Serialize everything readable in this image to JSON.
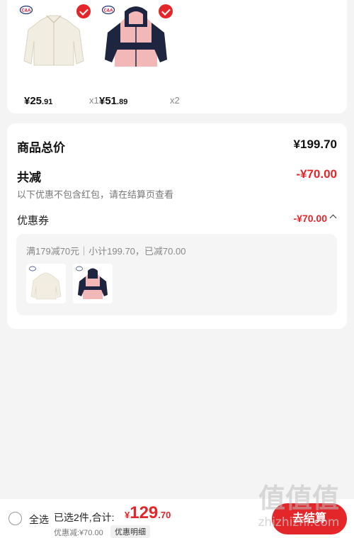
{
  "products": [
    {
      "name": "cream-fleece-jacket",
      "price_int": "¥25",
      "price_dec": ".91",
      "qty": "x1",
      "brand": "C&A"
    },
    {
      "name": "pink-navy-hooded-jacket",
      "price_int": "¥51",
      "price_dec": ".89",
      "qty": "x2",
      "brand": "C&A"
    }
  ],
  "summary": {
    "total_label": "商品总价",
    "total_value": "¥199.70",
    "discount_label": "共减",
    "discount_value": "-¥70.00",
    "note": "以下优惠不包含红包，请在结算页查看",
    "coupon_label": "优惠券",
    "coupon_value": "-¥70.00",
    "coupon_detail": "满179减70元｜小计199.70，已减70.00"
  },
  "bottom_bar": {
    "select_all": "全选",
    "selected_text": "已选2件,合计:",
    "total_yen": "¥",
    "total_int": "129",
    "total_dec": ".70",
    "discount_text": "优惠减:¥70.00",
    "detail_button": "优惠明细",
    "checkout_button": "去结算"
  },
  "watermark": {
    "big": "值值值",
    "small": "zhizhizhi.com"
  },
  "colors": {
    "accent": "#e3262a",
    "background": "#f4f4f4",
    "card": "#ffffff"
  }
}
